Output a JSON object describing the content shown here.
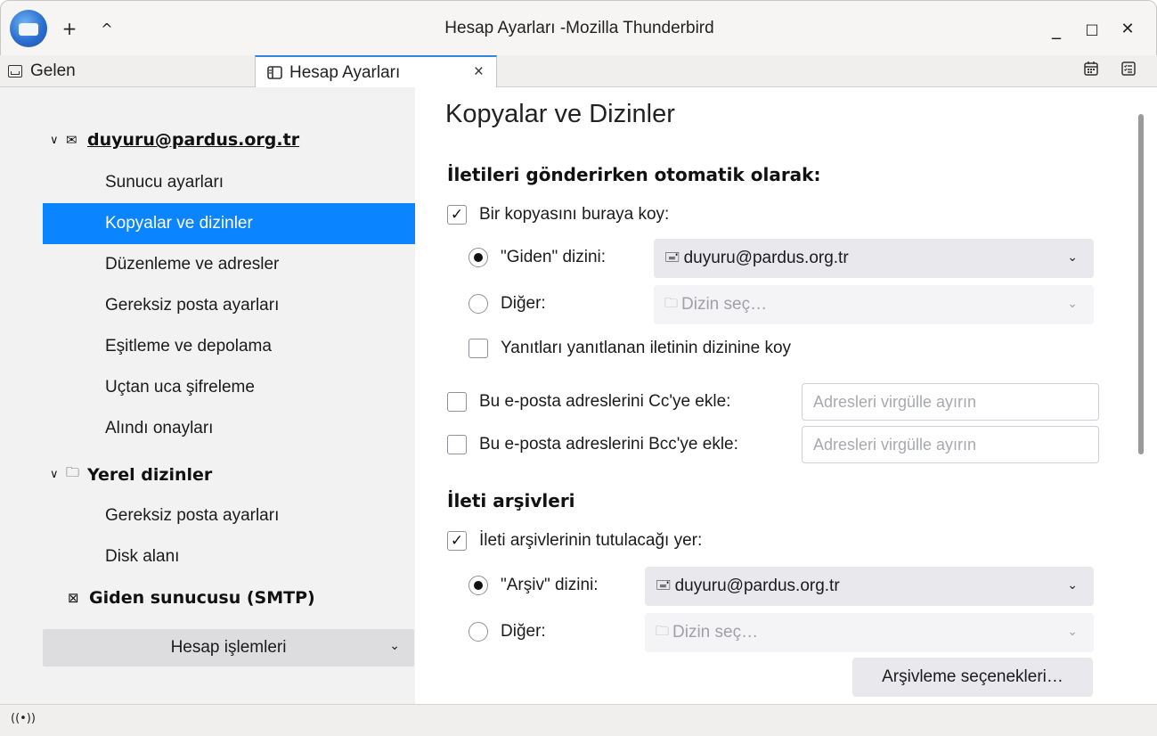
{
  "window": {
    "title": "Hesap Ayarları -Mozilla Thunderbird",
    "controls": {
      "new": "+",
      "up": "^",
      "minimize": "_",
      "maximize": "□",
      "close": "✕"
    }
  },
  "tabs": [
    {
      "label": "Gelen",
      "icon": "inbox-icon",
      "active": false
    },
    {
      "label": "Hesap Ayarları",
      "icon": "account-settings-icon",
      "active": true
    }
  ],
  "tab_close": "×",
  "toolbar_right_icons": [
    "calendar-icon",
    "tasks-icon"
  ],
  "sidebar": {
    "account": {
      "email": "duyuru@pardus.org.tr",
      "twisty": "∨",
      "icon": "✉"
    },
    "account_items": [
      {
        "label": "Sunucu ayarları",
        "selected": false
      },
      {
        "label": "Kopyalar ve dizinler",
        "selected": true
      },
      {
        "label": "Düzenleme ve adresler",
        "selected": false
      },
      {
        "label": "Gereksiz posta ayarları",
        "selected": false
      },
      {
        "label": "Eşitleme ve depolama",
        "selected": false
      },
      {
        "label": "Uçtan uca şifreleme",
        "selected": false
      },
      {
        "label": "Alındı onayları",
        "selected": false
      }
    ],
    "local": {
      "label": "Yerel dizinler",
      "twisty": "∨",
      "icon": "🗀"
    },
    "local_items": [
      {
        "label": "Gereksiz posta ayarları"
      },
      {
        "label": "Disk alanı"
      }
    ],
    "smtp": {
      "label": "Giden sunucusu (SMTP)",
      "icon": "⊠"
    },
    "account_actions": {
      "label": "Hesap işlemleri",
      "chevron": "⌄"
    }
  },
  "main": {
    "title": "Kopyalar ve Dizinler",
    "sent_section": {
      "heading": "İletileri gönderirken otomatik olarak:",
      "copy_checkbox": {
        "label": "Bir kopyasını buraya koy:",
        "checked": true
      },
      "sent_radio": {
        "label": "\"Giden\" dizini:",
        "selected": true,
        "value": "duyuru@pardus.org.tr",
        "icon": "🖃"
      },
      "other_radio": {
        "label": "Diğer:",
        "selected": false,
        "placeholder": "Dizin seç…",
        "icon": "🗀"
      },
      "replies_checkbox": {
        "label": "Yanıtları yanıtlanan iletinin dizinine koy",
        "checked": false
      },
      "cc_checkbox": {
        "label": "Bu e-posta adreslerini Cc'ye ekle:",
        "checked": false,
        "placeholder": "Adresleri virgülle ayırın"
      },
      "bcc_checkbox": {
        "label": "Bu e-posta adreslerini Bcc'ye ekle:",
        "checked": false,
        "placeholder": "Adresleri virgülle ayırın"
      }
    },
    "archive_section": {
      "heading": "İleti arşivleri",
      "keep_checkbox": {
        "label": "İleti arşivlerinin tutulacağı yer:",
        "checked": true
      },
      "archive_radio": {
        "label": "\"Arşiv\" dizini:",
        "selected": true,
        "value": "duyuru@pardus.org.tr",
        "icon": "🖃"
      },
      "other_radio": {
        "label": "Diğer:",
        "selected": false,
        "placeholder": "Dizin seç…",
        "icon": "🗀"
      },
      "options_button": "Arşivleme seçenekleri…"
    }
  },
  "statusbar": {
    "icon": "((•))"
  },
  "colors": {
    "accent": "#0a84ff",
    "sidebar_bg": "#f2f2f3",
    "button_bg": "#e9e9ed"
  }
}
